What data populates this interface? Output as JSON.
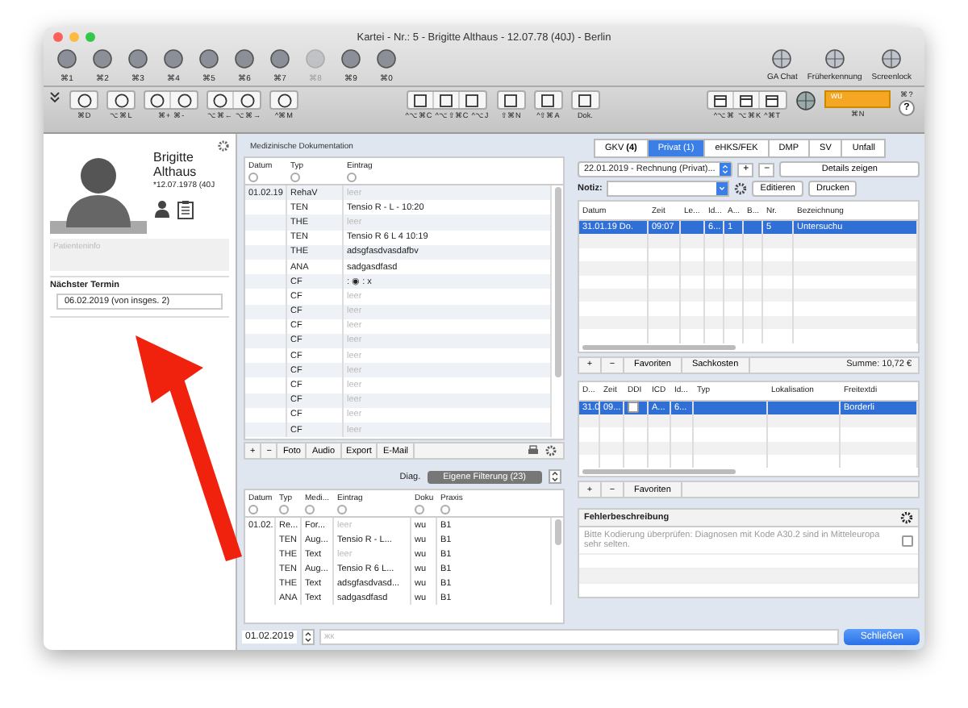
{
  "window": {
    "title": "Kartei - Nr.: 5 - Brigitte Althaus - 12.07.78 (40J) - Berlin"
  },
  "toolbar": {
    "left": [
      {
        "shortcut": "⌘1",
        "disabled": false
      },
      {
        "shortcut": "⌘2",
        "disabled": false
      },
      {
        "shortcut": "⌘3",
        "disabled": false
      },
      {
        "shortcut": "⌘4",
        "disabled": false
      },
      {
        "shortcut": "⌘5",
        "disabled": false
      },
      {
        "shortcut": "⌘6",
        "disabled": false
      },
      {
        "shortcut": "⌘7",
        "disabled": false
      },
      {
        "shortcut": "⌘8",
        "disabled": true
      },
      {
        "shortcut": "⌘9",
        "disabled": false
      },
      {
        "shortcut": "⌘0",
        "disabled": false
      }
    ],
    "right": [
      {
        "shortcut": "GA Chat",
        "disabled": false
      },
      {
        "shortcut": "Früherkennung",
        "disabled": false
      },
      {
        "shortcut": "Screenlock",
        "disabled": false
      }
    ]
  },
  "actionbar": {
    "left": [
      [
        "⌘D"
      ],
      [
        "⌥⌘L"
      ],
      [
        "⌘+",
        "⌘-"
      ],
      [
        "⌥⌘←",
        "⌥⌘→"
      ],
      [
        "^⌘M"
      ]
    ],
    "middle": [
      [
        "^⌥⌘C",
        "^⌥⇧⌘C",
        "^⌥J"
      ],
      [
        "⇧⌘N"
      ],
      [
        "^⇧⌘A"
      ],
      [
        "Dok."
      ]
    ],
    "right": [
      [
        "^⌥⌘",
        "⌥⌘K",
        "^⌘T"
      ]
    ],
    "user_field": "wu",
    "user_shortcut": "⌘N",
    "help": "?",
    "help_shortcut": "⌘?"
  },
  "patient": {
    "first_name": "Brigitte",
    "last_name": "Althaus",
    "birth": "*12.07.1978 (40J",
    "info_placeholder": "Patienteninfo",
    "next_label": "Nächster Termin",
    "next_value": "06.02.2019 (von insges. 2)"
  },
  "documentation": {
    "title": "Medizinische Dokumentation",
    "columns": [
      "Datum",
      "Typ",
      "Eintrag"
    ],
    "rows": [
      {
        "date": "01.02.19",
        "type": "RehaV",
        "entry": "leer",
        "empty": true
      },
      {
        "date": "",
        "type": "TEN",
        "entry": "Tensio  R -  L -  10:20",
        "empty": false
      },
      {
        "date": "",
        "type": "THE",
        "entry": "leer",
        "empty": true
      },
      {
        "date": "",
        "type": "TEN",
        "entry": "Tensio  R 6  L 4  10:19",
        "empty": false
      },
      {
        "date": "",
        "type": "THE",
        "entry": "adsgfasdvasdafbv",
        "empty": false
      },
      {
        "date": "",
        "type": "ANA",
        "entry": "sadgasdfasd",
        "empty": false
      },
      {
        "date": "",
        "type": "CF",
        "entry": ":  ◉ : x",
        "empty": false
      },
      {
        "date": "",
        "type": "CF",
        "entry": "leer",
        "empty": true
      },
      {
        "date": "",
        "type": "CF",
        "entry": "leer",
        "empty": true
      },
      {
        "date": "",
        "type": "CF",
        "entry": "leer",
        "empty": true
      },
      {
        "date": "",
        "type": "CF",
        "entry": "leer",
        "empty": true
      },
      {
        "date": "",
        "type": "CF",
        "entry": "leer",
        "empty": true
      },
      {
        "date": "",
        "type": "CF",
        "entry": "leer",
        "empty": true
      },
      {
        "date": "",
        "type": "CF",
        "entry": "leer",
        "empty": true
      },
      {
        "date": "",
        "type": "CF",
        "entry": "leer",
        "empty": true
      },
      {
        "date": "",
        "type": "CF",
        "entry": "leer",
        "empty": true
      },
      {
        "date": "",
        "type": "CF",
        "entry": "leer",
        "empty": true
      }
    ],
    "buttons": [
      "+",
      "−",
      "Foto",
      "Audio",
      "Export",
      "E-Mail"
    ]
  },
  "diagnosis_filter": {
    "label": "Diag.",
    "value": "Eigene Filterung (23)"
  },
  "entries": {
    "columns": [
      "Datum",
      "Typ",
      "Medi...",
      "Eintrag",
      "Doku",
      "Praxis"
    ],
    "rows": [
      {
        "cells": [
          "01.02.",
          "Re...",
          "For...",
          "leer",
          "wu",
          "B1"
        ],
        "empty": true
      },
      {
        "cells": [
          "",
          "TEN",
          "Aug...",
          "Tensio  R -  L...",
          "wu",
          "B1"
        ],
        "empty": false
      },
      {
        "cells": [
          "",
          "THE",
          "Text",
          "leer",
          "wu",
          "B1"
        ],
        "empty": true
      },
      {
        "cells": [
          "",
          "TEN",
          "Aug...",
          "Tensio  R 6  L...",
          "wu",
          "B1"
        ],
        "empty": false
      },
      {
        "cells": [
          "",
          "THE",
          "Text",
          "adsgfasdvasd...",
          "wu",
          "B1"
        ],
        "empty": false
      },
      {
        "cells": [
          "",
          "ANA",
          "Text",
          "sadgasdfasd",
          "wu",
          "B1"
        ],
        "empty": false
      }
    ]
  },
  "billing": {
    "tabs": [
      {
        "label": "GKV **(4)**",
        "selected": false
      },
      {
        "label": "Privat (1)",
        "selected": true
      },
      {
        "label": "eHKS/FEK",
        "selected": false
      },
      {
        "label": "DMP",
        "selected": false
      },
      {
        "label": "SV",
        "selected": false
      },
      {
        "label": "Unfall",
        "selected": false
      }
    ],
    "invoice": "22.01.2019 - Rechnung (Privat)...",
    "details_button": "Details zeigen",
    "note_label": "Notiz:",
    "edit_button": "Editieren",
    "print_button": "Drucken",
    "columns": [
      "Datum",
      "Zeit",
      "Le...",
      "Id...",
      "A...",
      "B...",
      "Nr.",
      "Bezeichnung"
    ],
    "rows": [
      {
        "cells": [
          "31.01.19  Do.",
          "09:07",
          "",
          "6...",
          "1",
          "",
          "5",
          "Untersuchu"
        ],
        "selected": true
      }
    ],
    "footer": [
      "+",
      "−",
      "Favoriten",
      "Sachkosten"
    ],
    "sum": "Summe: 10,72 €"
  },
  "diagnoses": {
    "columns": [
      "D...",
      "Zeit",
      "DDI",
      "ICD",
      "Id...",
      "Typ",
      "Lokalisation",
      "Freitextdi"
    ],
    "rows": [
      {
        "cells": [
          "31.0",
          "09...",
          "",
          "A...",
          "6...",
          "",
          "",
          "Borderli"
        ],
        "checked": false,
        "selected": true
      }
    ],
    "footer": [
      "+",
      "−",
      "Favoriten"
    ]
  },
  "errors": {
    "title": "Fehlerbeschreibung",
    "items": [
      {
        "text": "Bitte Kodierung überprüfen: Diagnosen mit Kode A30.2 sind in Mitteleuropa sehr selten.",
        "checked": false
      }
    ]
  },
  "bottom": {
    "date": "01.02.2019",
    "placeholder": "жк",
    "close_button": "Schließen"
  }
}
